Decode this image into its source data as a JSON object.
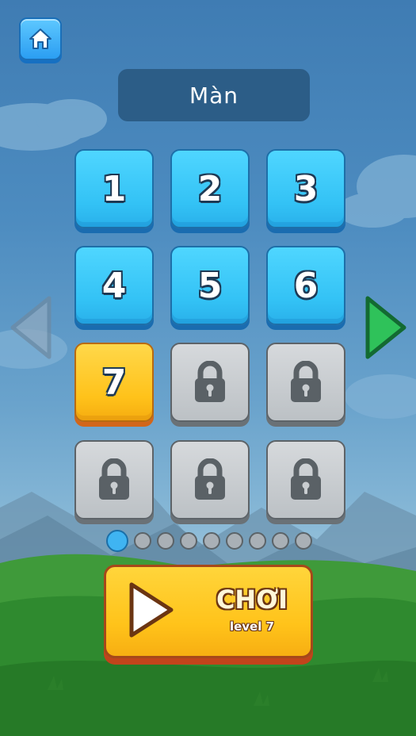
{
  "header": {
    "title": "Màn",
    "home_icon": "home-icon"
  },
  "levels": [
    {
      "label": "1",
      "state": "open"
    },
    {
      "label": "2",
      "state": "open"
    },
    {
      "label": "3",
      "state": "open"
    },
    {
      "label": "4",
      "state": "open"
    },
    {
      "label": "5",
      "state": "open"
    },
    {
      "label": "6",
      "state": "open"
    },
    {
      "label": "7",
      "state": "current"
    },
    {
      "label": "",
      "state": "locked"
    },
    {
      "label": "",
      "state": "locked"
    },
    {
      "label": "",
      "state": "locked"
    },
    {
      "label": "",
      "state": "locked"
    },
    {
      "label": "",
      "state": "locked"
    }
  ],
  "pager": {
    "page_count": 9,
    "current_page": 1
  },
  "play": {
    "label": "CHƠI",
    "sublabel": "level 7"
  },
  "colors": {
    "open_tile": "#33c2f5",
    "current_tile": "#ffc21a",
    "locked_tile": "#bcc1c5",
    "next_arrow": "#2fc25a",
    "prev_arrow": "#8fa9c0"
  }
}
